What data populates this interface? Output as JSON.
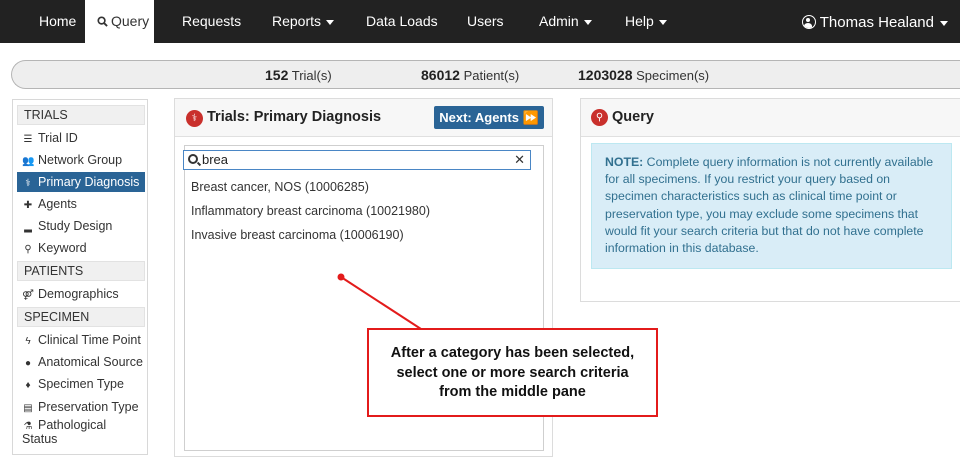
{
  "nav": {
    "items": [
      {
        "label": "Home"
      },
      {
        "label": "Query",
        "icon": "search-icon"
      },
      {
        "label": "Requests"
      },
      {
        "label": "Reports"
      },
      {
        "label": "Data Loads"
      },
      {
        "label": "Users"
      },
      {
        "label": "Admin"
      },
      {
        "label": "Help"
      }
    ],
    "user": "Thomas Healand"
  },
  "stats": {
    "trials_count": "152",
    "trials_label": "Trial(s)",
    "patients_count": "86012",
    "patients_label": "Patient(s)",
    "specimens_count": "1203028",
    "specimens_label": "Specimen(s)"
  },
  "sidebar": {
    "sections": [
      "TRIALS",
      "PATIENTS",
      "SPECIMEN"
    ],
    "trials_items": [
      "Trial ID",
      "Network Group",
      "Primary Diagnosis",
      "Agents",
      "Study Design",
      "Keyword"
    ],
    "patients_items": [
      "Demographics"
    ],
    "specimen_items": [
      "Clinical Time Point",
      "Anatomical Source",
      "Specimen Type",
      "Preservation Type",
      "Pathological",
      "Status"
    ]
  },
  "middle": {
    "title": "Trials: Primary Diagnosis",
    "next_label": "Next: Agents",
    "search_value": "brea",
    "results": [
      "Breast cancer, NOS (10006285)",
      "Inflammatory breast carcinoma (10021980)",
      "Invasive breast carcinoma (10006190)"
    ]
  },
  "right": {
    "title": "Query",
    "note_label": "NOTE:",
    "note_text": " Complete query information is not currently available for all specimens. If you restrict your query based on specimen characteristics such as clinical time point or preservation type, you may exclude some specimens that would fit your search criteria but that do not have complete information in this database."
  },
  "annotation": {
    "line1": "After a category has been selected,",
    "line2": "select one or more search criteria",
    "line3": "from the middle pane"
  },
  "colors": {
    "navbar": "#222222",
    "accent": "#2a6496",
    "icon_red": "#c9302c",
    "callout_red": "#e31b1b",
    "note_bg": "#d9edf7",
    "note_text": "#31708f"
  }
}
